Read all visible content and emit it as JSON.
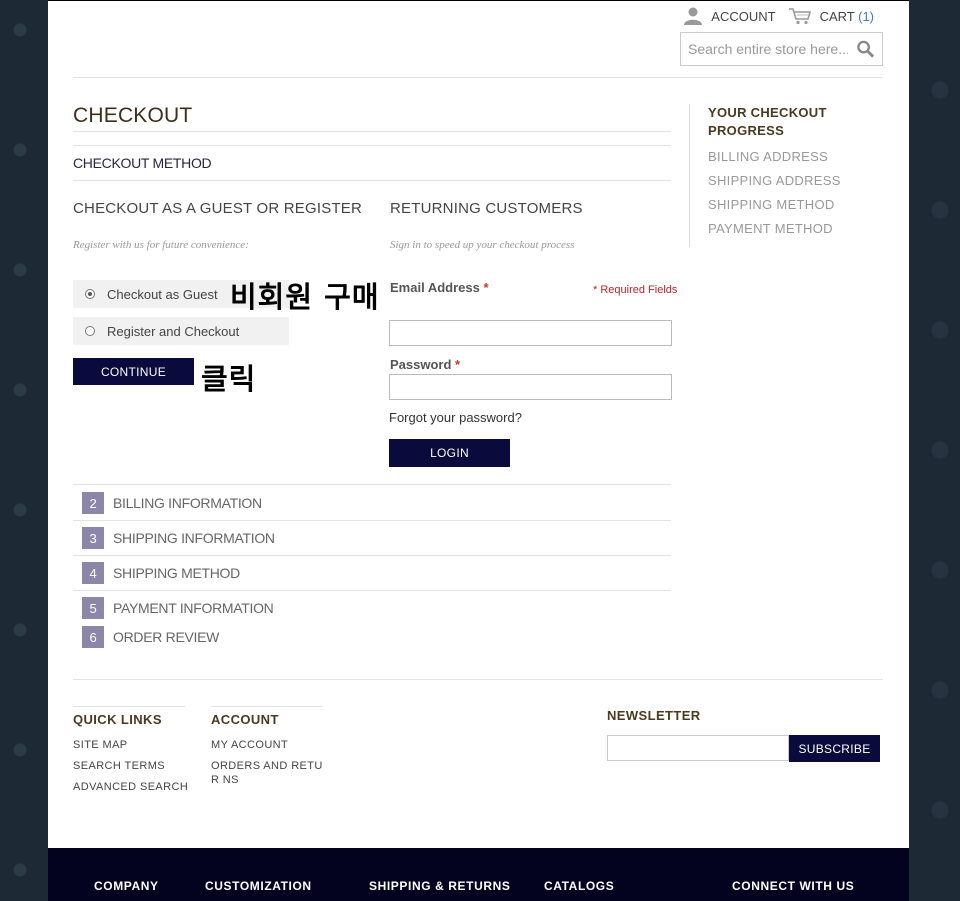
{
  "header": {
    "account_label": "ACCOUNT",
    "cart_label": "CART",
    "cart_count": "(1)",
    "search_placeholder": "Search entire store here..."
  },
  "checkout": {
    "title": "CHECKOUT",
    "method_title": "CHECKOUT METHOD",
    "guest": {
      "heading": "CHECKOUT AS A GUEST OR REGISTER",
      "note": "Register with us for future convenience:",
      "option_guest": "Checkout as Guest",
      "option_register": "Register and Checkout",
      "continue_label": "CONTINUE"
    },
    "returning": {
      "heading": "RETURNING CUSTOMERS",
      "note": "Sign in to speed up your checkout process",
      "email_label": "Email Address",
      "password_label": "Password",
      "required_star": "*",
      "required_note": "* Required Fields",
      "forgot": "Forgot your password?",
      "login_label": "LOGIN"
    },
    "steps": [
      {
        "num": "2",
        "label": "BILLING INFORMATION"
      },
      {
        "num": "3",
        "label": "SHIPPING INFORMATION"
      },
      {
        "num": "4",
        "label": "SHIPPING METHOD"
      },
      {
        "num": "5",
        "label": "PAYMENT INFORMATION"
      },
      {
        "num": "6",
        "label": "ORDER REVIEW"
      }
    ]
  },
  "annotations": {
    "guest": "비회원 구매",
    "click": "클릭"
  },
  "progress": {
    "title": "YOUR CHECKOUT PROGRESS",
    "items": [
      "BILLING ADDRESS",
      "SHIPPING ADDRESS",
      "SHIPPING METHOD",
      "PAYMENT METHOD"
    ]
  },
  "footer": {
    "quick_links": {
      "title": "QUICK LINKS",
      "items": [
        "SITE MAP",
        "SEARCH TERMS",
        "ADVANCED SEARCH"
      ]
    },
    "account": {
      "title": "ACCOUNT",
      "items": [
        "MY ACCOUNT",
        "ORDERS AND RETUR NS"
      ]
    },
    "newsletter": {
      "title": "NEWSLETTER",
      "subscribe_label": "SUBSCRIBE"
    },
    "bottom": [
      "COMPANY",
      "CUSTOMIZATION",
      "SHIPPING & RETURNS",
      "CATALOGS",
      "CONNECT WITH US"
    ]
  }
}
